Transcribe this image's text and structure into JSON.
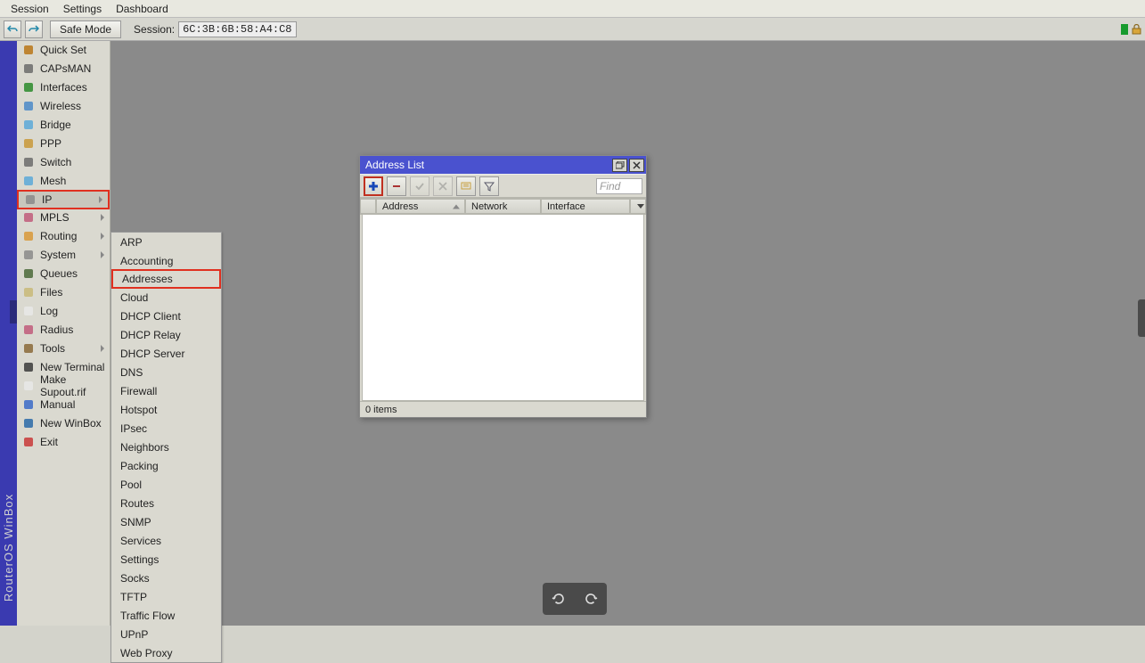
{
  "menubar": {
    "session": "Session",
    "settings": "Settings",
    "dashboard": "Dashboard"
  },
  "toolbar": {
    "safe_mode": "Safe Mode",
    "session_label": "Session:",
    "session_id": "6C:3B:6B:58:A4:C8"
  },
  "brand": "RouterOS WinBox",
  "sidebar": [
    {
      "name": "quick-set",
      "label": "Quick Set",
      "arrow": false,
      "color": "#b87518"
    },
    {
      "name": "capsman",
      "label": "CAPsMAN",
      "arrow": false,
      "color": "#6b6b6b"
    },
    {
      "name": "interfaces",
      "label": "Interfaces",
      "arrow": false,
      "color": "#2a8a2a"
    },
    {
      "name": "wireless",
      "label": "Wireless",
      "arrow": false,
      "color": "#4a88c8"
    },
    {
      "name": "bridge",
      "label": "Bridge",
      "arrow": false,
      "color": "#5aa8d8"
    },
    {
      "name": "ppp",
      "label": "PPP",
      "arrow": false,
      "color": "#c89838"
    },
    {
      "name": "switch",
      "label": "Switch",
      "arrow": false,
      "color": "#6b6b6b"
    },
    {
      "name": "mesh",
      "label": "Mesh",
      "arrow": false,
      "color": "#5aa8d8"
    },
    {
      "name": "ip",
      "label": "IP",
      "arrow": true,
      "selected": true,
      "color": "#8a8a8a"
    },
    {
      "name": "mpls",
      "label": "MPLS",
      "arrow": true,
      "color": "#c05a7a"
    },
    {
      "name": "routing",
      "label": "Routing",
      "arrow": true,
      "color": "#d89838"
    },
    {
      "name": "system",
      "label": "System",
      "arrow": true,
      "color": "#8a8a8a"
    },
    {
      "name": "queues",
      "label": "Queues",
      "arrow": false,
      "color": "#4a6838"
    },
    {
      "name": "files",
      "label": "Files",
      "arrow": false,
      "color": "#c8b878"
    },
    {
      "name": "log",
      "label": "Log",
      "arrow": false,
      "color": "#e8e8e8"
    },
    {
      "name": "radius",
      "label": "Radius",
      "arrow": false,
      "color": "#c05a7a"
    },
    {
      "name": "tools",
      "label": "Tools",
      "arrow": true,
      "color": "#8a6838"
    },
    {
      "name": "new-terminal",
      "label": "New Terminal",
      "arrow": false,
      "color": "#3a3a3a"
    },
    {
      "name": "make-supout",
      "label": "Make Supout.rif",
      "arrow": false,
      "color": "#e8e8e8"
    },
    {
      "name": "manual",
      "label": "Manual",
      "arrow": false,
      "color": "#3a6ac8"
    },
    {
      "name": "new-winbox",
      "label": "New WinBox",
      "arrow": false,
      "color": "#2a6aa8"
    },
    {
      "name": "exit",
      "label": "Exit",
      "arrow": false,
      "color": "#c83838"
    }
  ],
  "submenu": [
    {
      "name": "arp",
      "label": "ARP"
    },
    {
      "name": "accounting",
      "label": "Accounting"
    },
    {
      "name": "addresses",
      "label": "Addresses",
      "selected": true
    },
    {
      "name": "cloud",
      "label": "Cloud"
    },
    {
      "name": "dhcp-client",
      "label": "DHCP Client"
    },
    {
      "name": "dhcp-relay",
      "label": "DHCP Relay"
    },
    {
      "name": "dhcp-server",
      "label": "DHCP Server"
    },
    {
      "name": "dns",
      "label": "DNS"
    },
    {
      "name": "firewall",
      "label": "Firewall"
    },
    {
      "name": "hotspot",
      "label": "Hotspot"
    },
    {
      "name": "ipsec",
      "label": "IPsec"
    },
    {
      "name": "neighbors",
      "label": "Neighbors"
    },
    {
      "name": "packing",
      "label": "Packing"
    },
    {
      "name": "pool",
      "label": "Pool"
    },
    {
      "name": "routes",
      "label": "Routes"
    },
    {
      "name": "snmp",
      "label": "SNMP"
    },
    {
      "name": "services",
      "label": "Services"
    },
    {
      "name": "settings",
      "label": "Settings"
    },
    {
      "name": "socks",
      "label": "Socks"
    },
    {
      "name": "tftp",
      "label": "TFTP"
    },
    {
      "name": "traffic-flow",
      "label": "Traffic Flow"
    },
    {
      "name": "upnp",
      "label": "UPnP"
    },
    {
      "name": "web-proxy",
      "label": "Web Proxy"
    }
  ],
  "window": {
    "title": "Address List",
    "find_placeholder": "Find",
    "cols": {
      "address": "Address",
      "network": "Network",
      "interface": "Interface"
    },
    "status": "0 items"
  }
}
